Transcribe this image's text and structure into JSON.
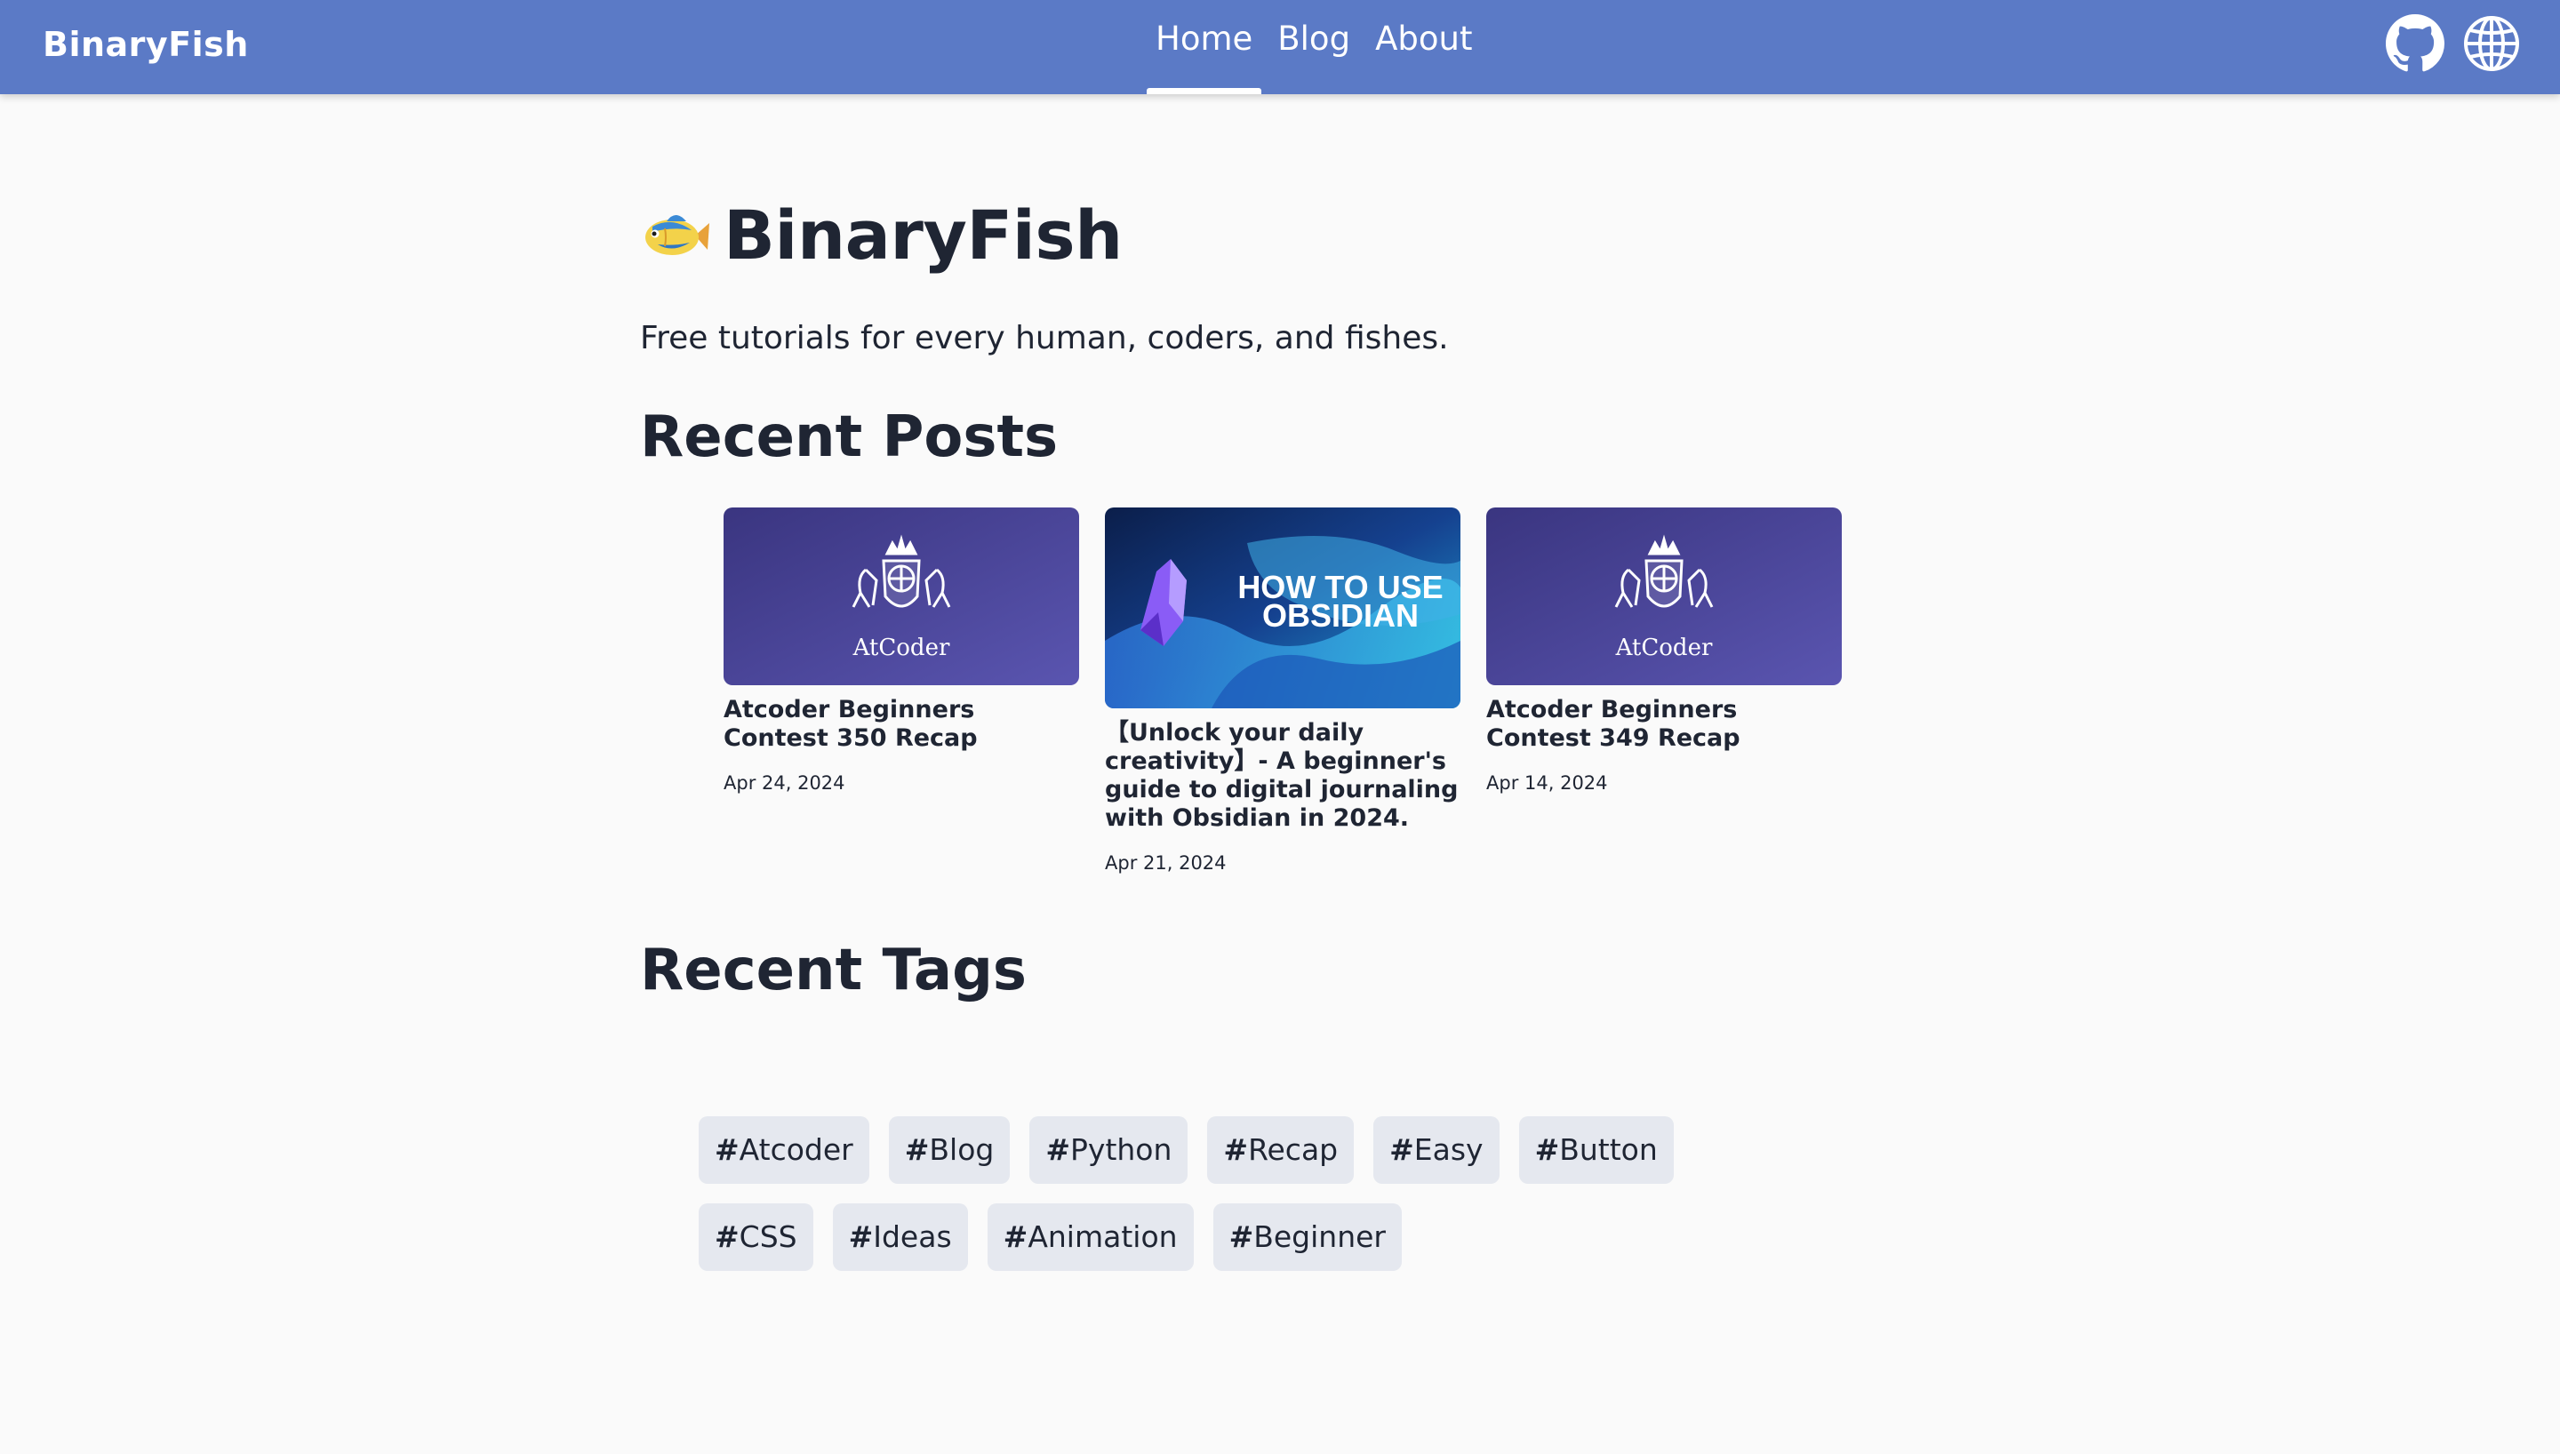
{
  "header": {
    "brand": "BinaryFish",
    "nav": [
      {
        "label": "Home",
        "active": true
      },
      {
        "label": "Blog",
        "active": false
      },
      {
        "label": "About",
        "active": false
      }
    ],
    "icons": [
      "github-icon",
      "globe-icon"
    ],
    "bar_color": "#5b7ac6"
  },
  "hero": {
    "emoji_icon": "fish-icon",
    "title": "BinaryFish",
    "tagline": "Free tutorials for every human, coders, and fishes."
  },
  "recent_posts": {
    "heading": "Recent Posts",
    "posts": [
      {
        "thumb_icon": "atcoder-logo",
        "thumb_caption": "AtCoder",
        "title": "Atcoder Beginners Contest 350 Recap",
        "date": "Apr 24, 2024"
      },
      {
        "thumb_icon": "obsidian-logo",
        "thumb_caption_line1": "HOW TO USE",
        "thumb_caption_line2": "OBSIDIAN",
        "title": "【Unlock your daily creativity】- A beginner's guide to digital journaling with Obsidian in 2024.",
        "date": "Apr 21, 2024"
      },
      {
        "thumb_icon": "atcoder-logo",
        "thumb_caption": "AtCoder",
        "title": "Atcoder Beginners Contest 349 Recap",
        "date": "Apr 14, 2024"
      }
    ]
  },
  "recent_tags": {
    "heading": "Recent Tags",
    "hash": "#",
    "tags": [
      "Atcoder",
      "Blog",
      "Python",
      "Recap",
      "Easy",
      "Button",
      "CSS",
      "Ideas",
      "Animation",
      "Beginner"
    ]
  }
}
